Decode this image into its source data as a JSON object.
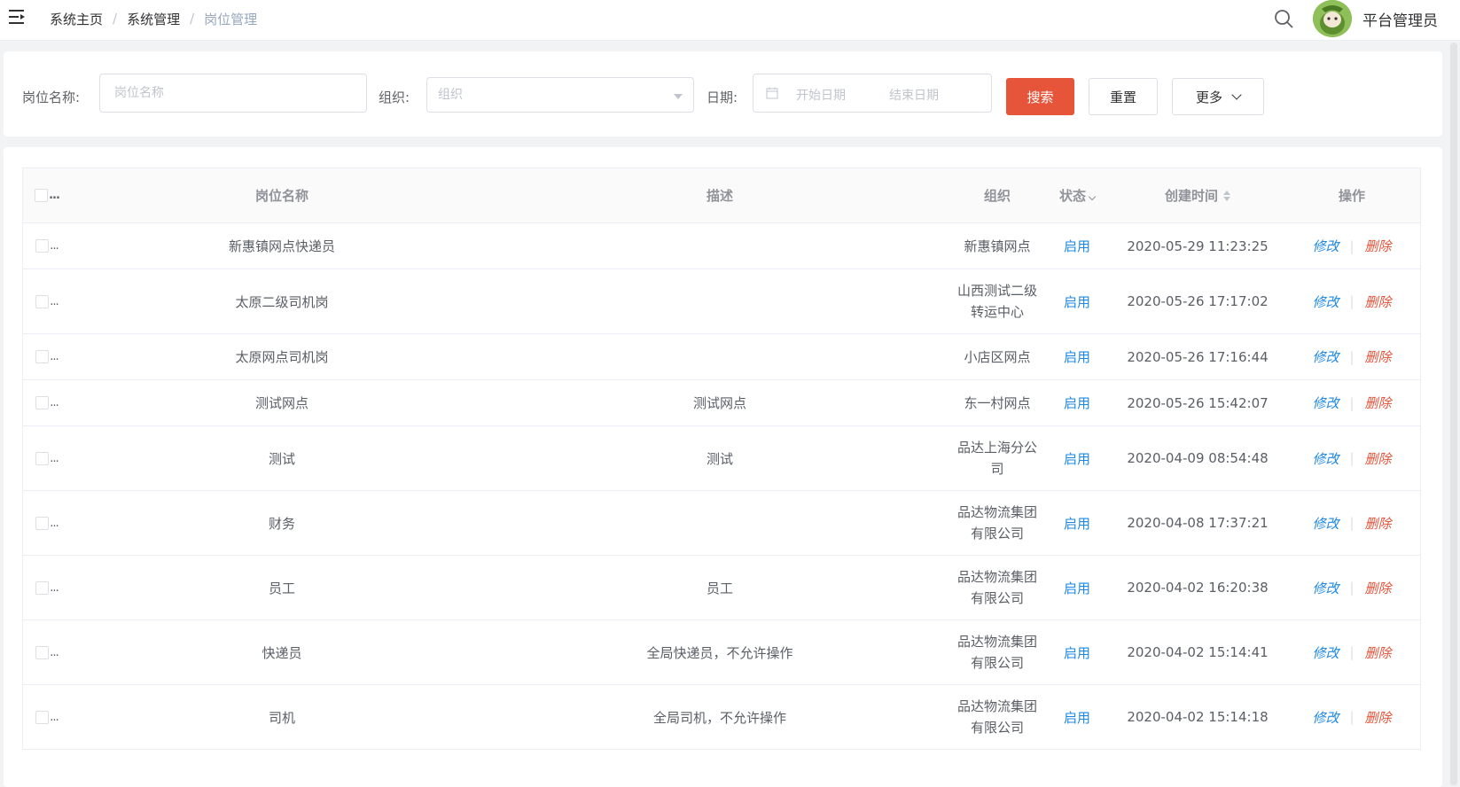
{
  "breadcrumb": {
    "items": [
      "系统主页",
      "系统管理",
      "岗位管理"
    ],
    "separator": "/"
  },
  "user": {
    "name": "平台管理员"
  },
  "filters": {
    "name_label": "岗位名称:",
    "name_placeholder": "岗位名称",
    "org_label": "组织:",
    "org_placeholder": "组织",
    "date_label": "日期:",
    "start_placeholder": "开始日期",
    "end_placeholder": "结束日期",
    "search_label": "搜索",
    "reset_label": "重置",
    "more_label": "更多"
  },
  "table": {
    "headers": {
      "select": "...",
      "name": "岗位名称",
      "desc": "描述",
      "org": "组织",
      "status": "状态",
      "time": "创建时间",
      "ops": "操作"
    },
    "edit_label": "修改",
    "delete_label": "删除",
    "op_separator": "|",
    "rows": [
      {
        "name": "新惠镇网点快递员",
        "desc": "",
        "org": "新惠镇网点",
        "status": "启用",
        "time": "2020-05-29 11:23:25"
      },
      {
        "name": "太原二级司机岗",
        "desc": "",
        "org": "山西测试二级转运中心",
        "status": "启用",
        "time": "2020-05-26 17:17:02"
      },
      {
        "name": "太原网点司机岗",
        "desc": "",
        "org": "小店区网点",
        "status": "启用",
        "time": "2020-05-26 17:16:44"
      },
      {
        "name": "测试网点",
        "desc": "测试网点",
        "org": "东一村网点",
        "status": "启用",
        "time": "2020-05-26 15:42:07"
      },
      {
        "name": "测试",
        "desc": "测试",
        "org": "品达上海分公司",
        "status": "启用",
        "time": "2020-04-09 08:54:48"
      },
      {
        "name": "财务",
        "desc": "",
        "org": "品达物流集团有限公司",
        "status": "启用",
        "time": "2020-04-08 17:37:21"
      },
      {
        "name": "员工",
        "desc": "员工",
        "org": "品达物流集团有限公司",
        "status": "启用",
        "time": "2020-04-02 16:20:38"
      },
      {
        "name": "快递员",
        "desc": "全局快递员，不允许操作",
        "org": "品达物流集团有限公司",
        "status": "启用",
        "time": "2020-04-02 15:14:41"
      },
      {
        "name": "司机",
        "desc": "全局司机，不允许操作",
        "org": "品达物流集团有限公司",
        "status": "启用",
        "time": "2020-04-02 15:14:18"
      }
    ]
  },
  "colors": {
    "primary_button": "#e6553a",
    "link_blue": "#1e88e5",
    "delete_red": "#e5533a"
  }
}
